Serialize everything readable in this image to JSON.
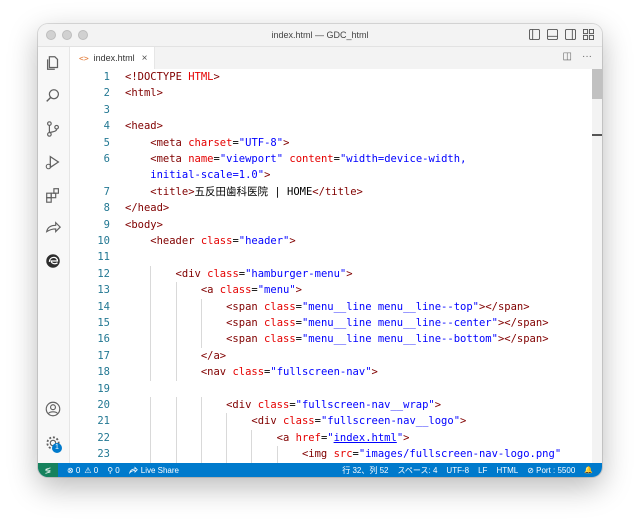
{
  "window": {
    "title": "index.html — GDC_html"
  },
  "tab": {
    "label": "index.html",
    "icon": "<>",
    "close": "×"
  },
  "tab_actions": {
    "split": "◫",
    "more": "···"
  },
  "code": [
    {
      "n": "1",
      "indent": 0,
      "tokens": [
        [
          "t",
          "<!DOCTYPE "
        ],
        [
          "a",
          "HTML"
        ],
        [
          "t",
          ">"
        ]
      ]
    },
    {
      "n": "2",
      "indent": 0,
      "tokens": [
        [
          "t",
          "<html>"
        ]
      ]
    },
    {
      "n": "3",
      "indent": 0,
      "tokens": []
    },
    {
      "n": "4",
      "indent": 0,
      "tokens": [
        [
          "t",
          "<head>"
        ]
      ]
    },
    {
      "n": "5",
      "indent": 1,
      "tokens": [
        [
          "t",
          "<meta "
        ],
        [
          "a",
          "charset"
        ],
        [
          "x",
          "="
        ],
        [
          "s",
          "\"UTF-8\""
        ],
        [
          "t",
          ">"
        ]
      ]
    },
    {
      "n": "6",
      "indent": 1,
      "tokens": [
        [
          "t",
          "<meta "
        ],
        [
          "a",
          "name"
        ],
        [
          "x",
          "="
        ],
        [
          "s",
          "\"viewport\""
        ],
        [
          "x",
          " "
        ],
        [
          "a",
          "content"
        ],
        [
          "x",
          "="
        ],
        [
          "s",
          "\"width=device-width,"
        ]
      ]
    },
    {
      "n": "",
      "indent": 1,
      "tokens": [
        [
          "s",
          "initial-scale=1.0\""
        ],
        [
          "t",
          ">"
        ]
      ]
    },
    {
      "n": "7",
      "indent": 1,
      "tokens": [
        [
          "t",
          "<title>"
        ],
        [
          "x",
          "五反田歯科医院 | HOME"
        ],
        [
          "t",
          "</title>"
        ]
      ]
    },
    {
      "n": "8",
      "indent": 0,
      "tokens": [
        [
          "t",
          "</head>"
        ]
      ]
    },
    {
      "n": "9",
      "indent": 0,
      "tokens": [
        [
          "t",
          "<body>"
        ]
      ]
    },
    {
      "n": "10",
      "indent": 1,
      "tokens": [
        [
          "t",
          "<header "
        ],
        [
          "a",
          "class"
        ],
        [
          "x",
          "="
        ],
        [
          "s",
          "\"header\""
        ],
        [
          "t",
          ">"
        ]
      ]
    },
    {
      "n": "11",
      "indent": 0,
      "tokens": []
    },
    {
      "n": "12",
      "indent": 2,
      "tokens": [
        [
          "t",
          "<div "
        ],
        [
          "a",
          "class"
        ],
        [
          "x",
          "="
        ],
        [
          "s",
          "\"hamburger-menu\""
        ],
        [
          "t",
          ">"
        ]
      ]
    },
    {
      "n": "13",
      "indent": 3,
      "tokens": [
        [
          "t",
          "<a "
        ],
        [
          "a",
          "class"
        ],
        [
          "x",
          "="
        ],
        [
          "s",
          "\"menu\""
        ],
        [
          "t",
          ">"
        ]
      ]
    },
    {
      "n": "14",
      "indent": 4,
      "tokens": [
        [
          "t",
          "<span "
        ],
        [
          "a",
          "class"
        ],
        [
          "x",
          "="
        ],
        [
          "s",
          "\"menu__line menu__line--top\""
        ],
        [
          "t",
          "></span>"
        ]
      ]
    },
    {
      "n": "15",
      "indent": 4,
      "tokens": [
        [
          "t",
          "<span "
        ],
        [
          "a",
          "class"
        ],
        [
          "x",
          "="
        ],
        [
          "s",
          "\"menu__line menu__line--center\""
        ],
        [
          "t",
          "></span>"
        ]
      ]
    },
    {
      "n": "16",
      "indent": 4,
      "tokens": [
        [
          "t",
          "<span "
        ],
        [
          "a",
          "class"
        ],
        [
          "x",
          "="
        ],
        [
          "s",
          "\"menu__line menu__line--bottom\""
        ],
        [
          "t",
          "></span>"
        ]
      ]
    },
    {
      "n": "17",
      "indent": 3,
      "tokens": [
        [
          "t",
          "</a>"
        ]
      ]
    },
    {
      "n": "18",
      "indent": 3,
      "tokens": [
        [
          "t",
          "<nav "
        ],
        [
          "a",
          "class"
        ],
        [
          "x",
          "="
        ],
        [
          "s",
          "\"fullscreen-nav\""
        ],
        [
          "t",
          ">"
        ]
      ]
    },
    {
      "n": "19",
      "indent": 0,
      "tokens": []
    },
    {
      "n": "20",
      "indent": 4,
      "tokens": [
        [
          "t",
          "<div "
        ],
        [
          "a",
          "class"
        ],
        [
          "x",
          "="
        ],
        [
          "s",
          "\"fullscreen-nav__wrap\""
        ],
        [
          "t",
          ">"
        ]
      ]
    },
    {
      "n": "21",
      "indent": 5,
      "tokens": [
        [
          "t",
          "<div "
        ],
        [
          "a",
          "class"
        ],
        [
          "x",
          "="
        ],
        [
          "s",
          "\"fullscreen-nav__logo\""
        ],
        [
          "t",
          ">"
        ]
      ]
    },
    {
      "n": "22",
      "indent": 6,
      "tokens": [
        [
          "t",
          "<a "
        ],
        [
          "a",
          "href"
        ],
        [
          "x",
          "="
        ],
        [
          "s",
          "\""
        ],
        [
          "l",
          "index.html"
        ],
        [
          "s",
          "\""
        ],
        [
          "t",
          ">"
        ]
      ]
    },
    {
      "n": "23",
      "indent": 7,
      "tokens": [
        [
          "t",
          "<img "
        ],
        [
          "a",
          "src"
        ],
        [
          "x",
          "="
        ],
        [
          "s",
          "\"images/fullscreen-nav-logo.png\""
        ]
      ]
    }
  ],
  "status": {
    "remote": "≶",
    "errors": "⊗ 0",
    "warnings": "⚠ 0",
    "ports_icon": "⚲ 0",
    "live_share": "Live Share",
    "position": "行 32、列 52",
    "spaces": "スペース: 4",
    "encoding": "UTF-8",
    "eol": "LF",
    "language": "HTML",
    "port": "⊘ Port : 5500",
    "notifications": "🔔"
  },
  "accounts_badge": "1",
  "colors": {
    "status_bar": "#007acc",
    "remote": "#16825d",
    "tag": "#800000",
    "attribute": "#e50000",
    "string": "#0000ff",
    "line_number": "#237893"
  }
}
